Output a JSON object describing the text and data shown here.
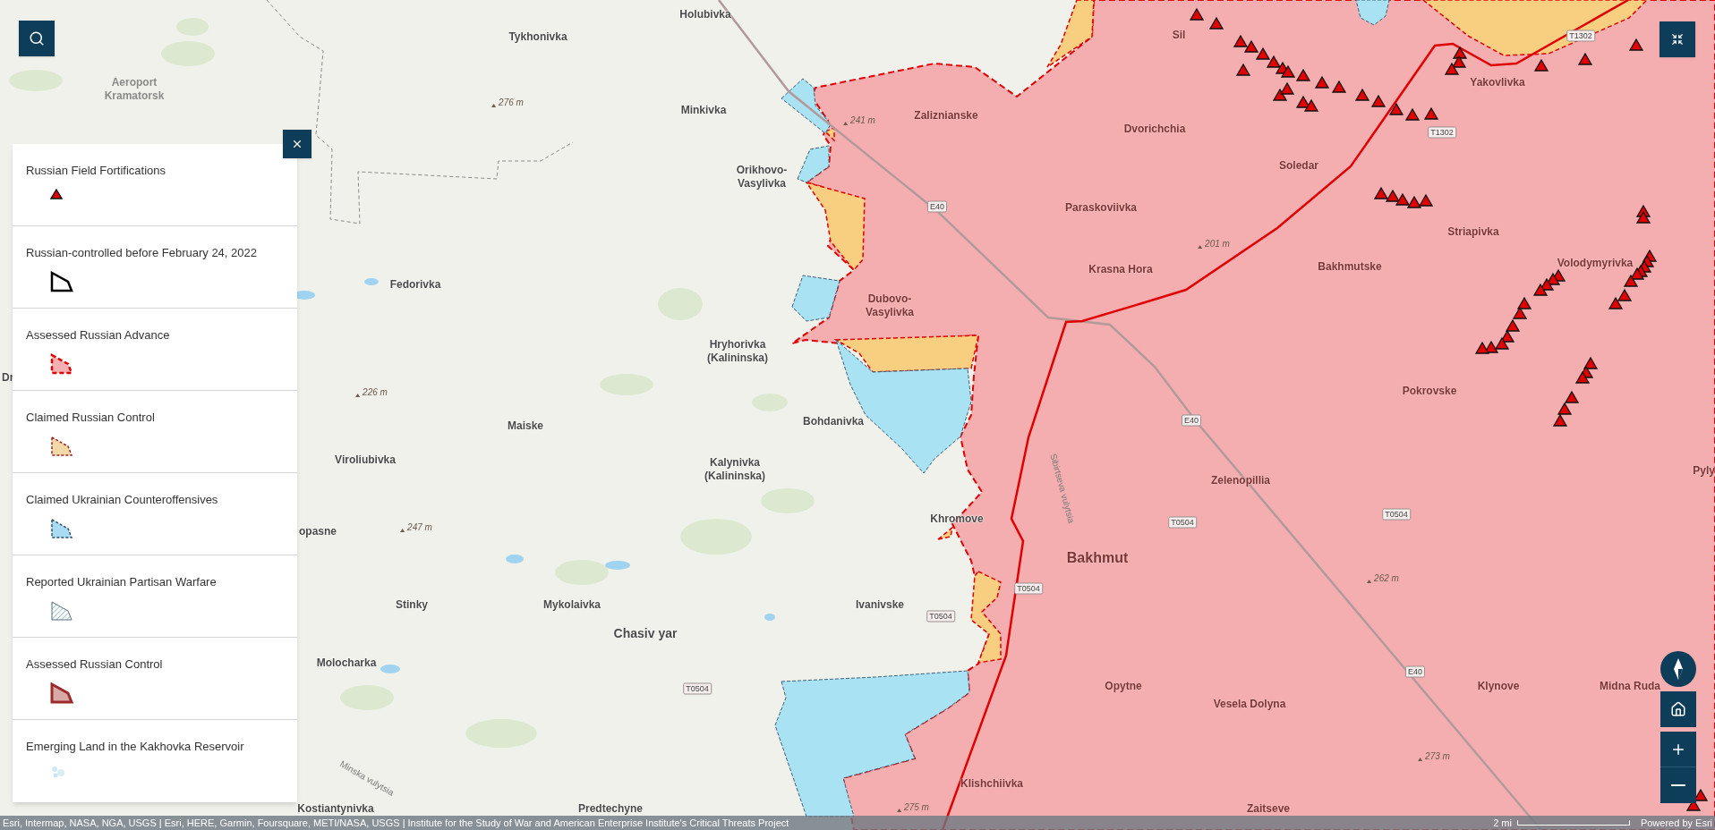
{
  "legend": {
    "items": [
      {
        "title": "Russian Field Fortifications",
        "kind": "triangle"
      },
      {
        "title": "Russian-controlled before February 24, 2022",
        "kind": "outline"
      },
      {
        "title": "Assessed Russian Advance",
        "kind": "dashed-red"
      },
      {
        "title": "Claimed Russian Control",
        "kind": "dashed-orange"
      },
      {
        "title": "Claimed Ukrainian Counteroffensives",
        "kind": "dashed-blue"
      },
      {
        "title": "Reported Ukrainian Partisan Warfare",
        "kind": "hatched"
      },
      {
        "title": "Assessed Russian Control",
        "kind": "solid-red"
      },
      {
        "title": "Emerging Land in the Kakhovka Reservoir",
        "kind": "speckle"
      }
    ]
  },
  "places": [
    "Holubivka",
    "Sil",
    "Tykhonivka",
    "Yakovlivka",
    "Aeroport Kramatorsk",
    "Minkivka",
    "Zaliznianske",
    "Dvorichchia",
    "Soledar",
    "Orikhovo-Vasylivka",
    "Paraskoviivka",
    "Striapivka",
    "Bakhmutske",
    "Volodymyrivka",
    "Krasna Hora",
    "Fedorivka",
    "Dubovo-Vasylivka",
    "Hryhorivka (Kalininska)",
    "Dr",
    "Pokrovske",
    "Bohdanivka",
    "Maiske",
    "Viroliubivka",
    "Kalynivka (Kalininska)",
    "Pyly",
    "Zelenopillia",
    "Khromove",
    "opasne",
    "Bakhmut",
    "Stinky",
    "Mykolaivka",
    "Ivanivske",
    "Chasiv yar",
    "Molocharka",
    "Opytne",
    "Klynove",
    "Midna Ruda",
    "Vesela Dolyna",
    "Klishchiivka",
    "Kostiantynivka",
    "Predtechyne",
    "Zaitseve"
  ],
  "elevations": [
    "276 m",
    "241 m",
    "201 m",
    "226 m",
    "247 m",
    "262 m",
    "273 m",
    "275 m"
  ],
  "road_shields": [
    "T1302",
    "T1302",
    "E40",
    "E40",
    "T0504",
    "T0504",
    "T0504",
    "T0504",
    "E40",
    "T0504"
  ],
  "streets": [
    "Sibirtseva vulytsia",
    "Minska vulytsia"
  ],
  "attribution": "Esri, Intermap, NASA, NGA, USGS | Esri, HERE, Garmin, Foursquare, METI/NASA, USGS | Institute for the Study of War and American Enterprise Institute's Critical Threats Project",
  "scale_bar": {
    "label": "2 mi"
  },
  "powered_by": "Powered by Esri"
}
